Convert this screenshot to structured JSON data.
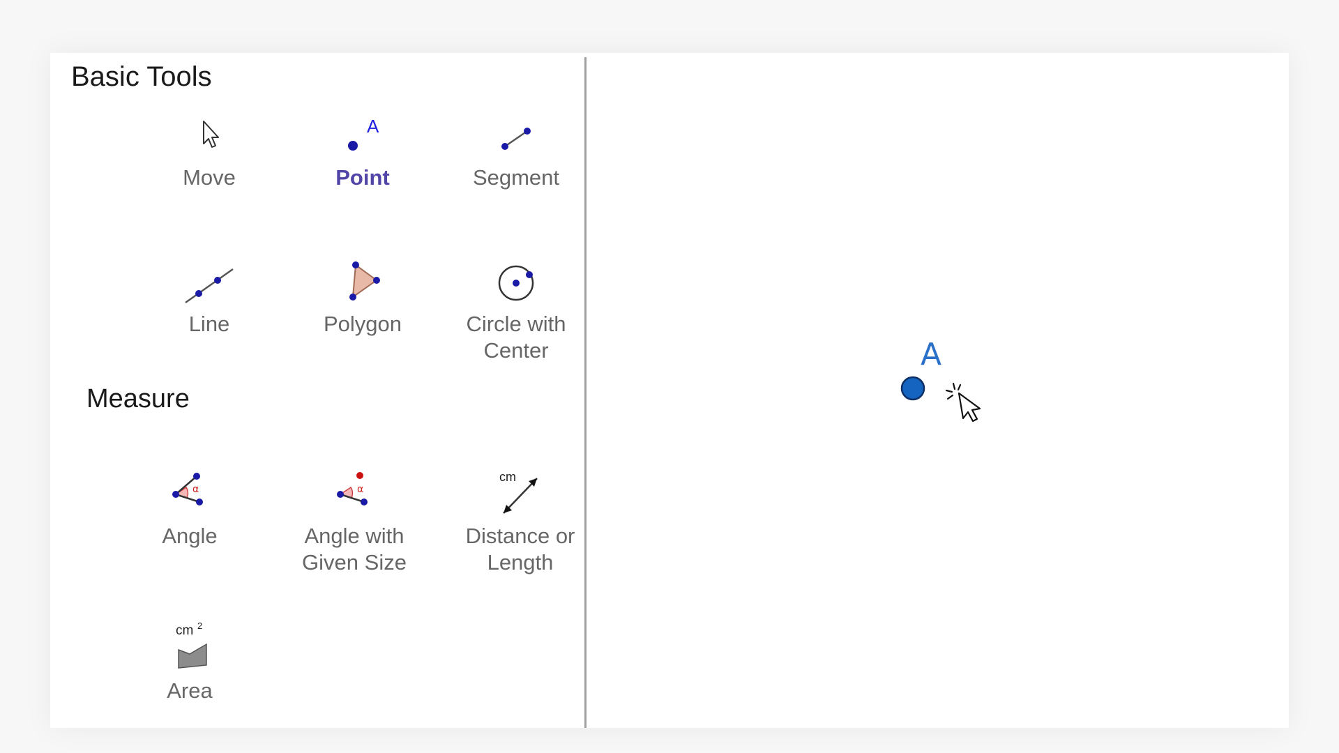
{
  "panel": {
    "basic_title": "Basic Tools",
    "measure_title": "Measure"
  },
  "tools": {
    "move": {
      "label": "Move",
      "icon": "move-cursor-icon"
    },
    "point": {
      "label": "Point",
      "icon": "point-icon",
      "icon_letter": "A",
      "active": true
    },
    "segment": {
      "label": "Segment",
      "icon": "segment-icon"
    },
    "line": {
      "label": "Line",
      "icon": "line-icon"
    },
    "polygon": {
      "label": "Polygon",
      "icon": "polygon-icon"
    },
    "circle": {
      "label_line1": "Circle with",
      "label_line2": "Center",
      "icon": "circle-center-icon"
    },
    "angle": {
      "label": "Angle",
      "icon": "angle-icon",
      "icon_symbol": "α"
    },
    "angle_given": {
      "label_line1": "Angle with",
      "label_line2": "Given Size",
      "icon": "angle-given-size-icon",
      "icon_symbol": "α"
    },
    "distance": {
      "label_line1": "Distance or",
      "label_line2": "Length",
      "icon": "distance-icon",
      "icon_unit": "cm"
    },
    "area": {
      "label": "Area",
      "icon": "area-icon",
      "icon_unit": "cm",
      "icon_exp": "2"
    }
  },
  "graphics": {
    "point_label": "A",
    "point_color": "#1565c0"
  },
  "colors": {
    "active_label": "#5145a8",
    "inactive_label": "#666666",
    "point_dot": "#1a1aa6",
    "divider": "#a0a0a0"
  }
}
